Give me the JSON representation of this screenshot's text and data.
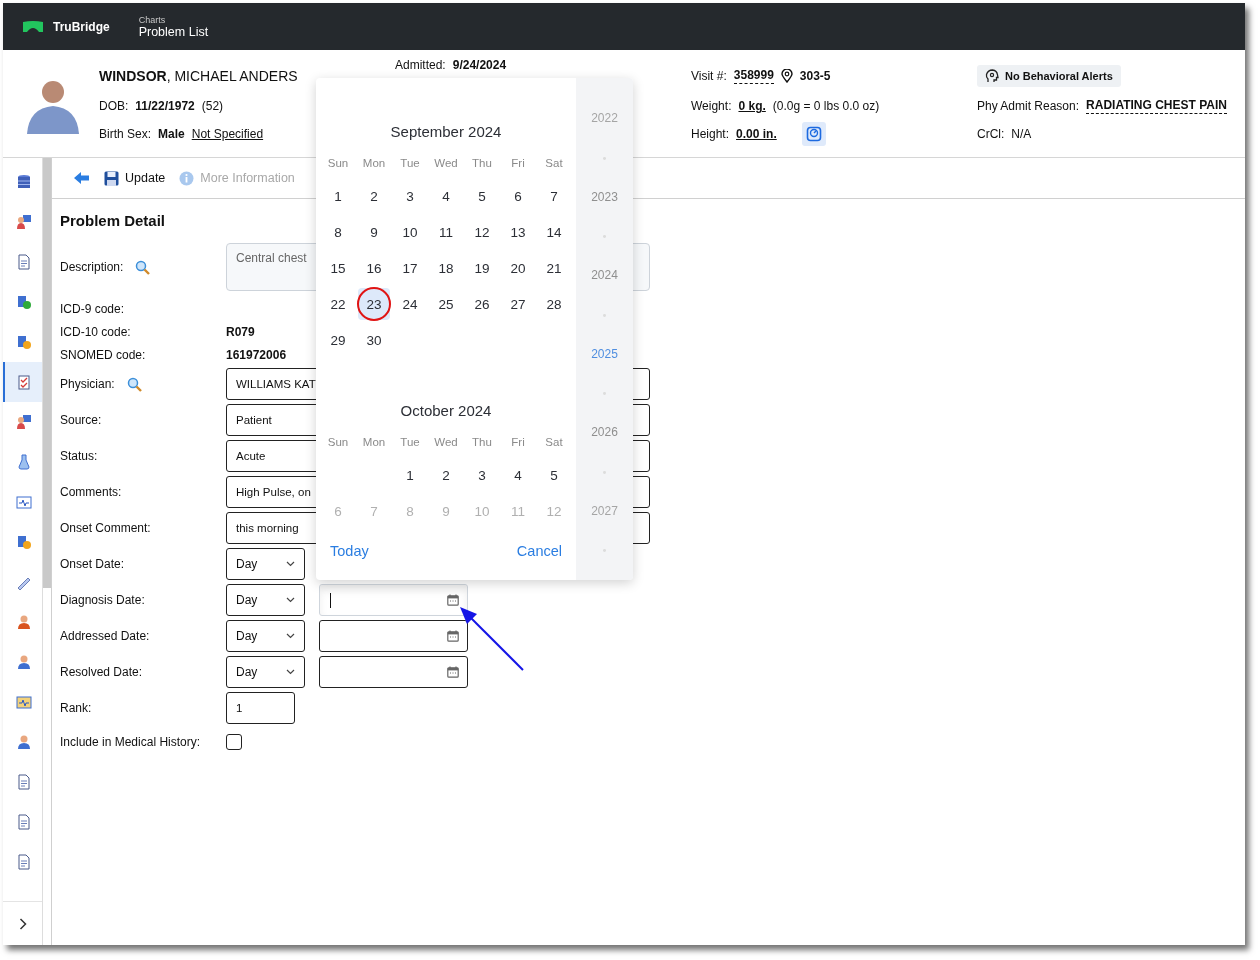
{
  "topbar": {
    "brand": "TruBridge",
    "section": "Charts",
    "page": "Problem List"
  },
  "patient": {
    "name": "**WINDSOR**, MICHAEL ANDERS",
    "dob_label": "DOB:",
    "dob": "11/22/1972",
    "age": "(52)",
    "sex_label": "Birth Sex:",
    "sex": "Male",
    "gender": "Not Specified",
    "admitted_label": "Admitted:",
    "admitted": "9/24/2024",
    "visit_label": "Visit #:",
    "visit": "358999",
    "room": "303-5",
    "weight_label": "Weight:",
    "weight": "0 kg.",
    "weight_detail": "(0.0g = 0 lbs 0.0 oz)",
    "height_label": "Height:",
    "height": "0.00 in.",
    "alerts": "No Behavioral Alerts",
    "reason_label": "Phy Admit Reason:",
    "reason": "RADIATING CHEST PAIN",
    "crcl_label": "CrCl:",
    "crcl": "N/A"
  },
  "sidebar": {
    "items": [
      {
        "selected": false
      },
      {
        "selected": false
      },
      {
        "selected": false
      },
      {
        "selected": false
      },
      {
        "selected": false
      },
      {
        "selected": true
      },
      {
        "selected": false
      },
      {
        "selected": false
      },
      {
        "selected": false
      },
      {
        "selected": false
      },
      {
        "selected": false
      },
      {
        "selected": false
      },
      {
        "selected": false
      },
      {
        "selected": false
      },
      {
        "selected": false
      },
      {
        "selected": false
      },
      {
        "selected": false
      },
      {
        "selected": false
      }
    ]
  },
  "toolbar": [
    {
      "kind": "back",
      "disabled": false
    },
    {
      "kind": "save",
      "label": "Update",
      "disabled": false
    },
    {
      "kind": "info",
      "label": "More Information",
      "disabled": true
    }
  ],
  "form": {
    "title": "Problem Detail",
    "rows": [
      {
        "kind": "textarea",
        "label": "Description:",
        "lookup": true,
        "value": "Central chest"
      },
      {
        "kind": "code",
        "label": "ICD-9 code:",
        "lookup": false
      },
      {
        "kind": "code",
        "label": "ICD-10 code:",
        "lookup": false,
        "value": "R079"
      },
      {
        "kind": "code",
        "label": "SNOMED code:",
        "lookup": false,
        "value": "161972006"
      },
      {
        "kind": "text",
        "label": "Physician:",
        "lookup": true,
        "value": "WILLIAMS KAT"
      },
      {
        "kind": "text",
        "label": "Source:",
        "lookup": false,
        "value": "Patient"
      },
      {
        "kind": "text",
        "label": "Status:",
        "lookup": false,
        "value": "Acute"
      },
      {
        "kind": "text",
        "label": "Comments:",
        "lookup": false,
        "value": "High Pulse, on"
      },
      {
        "kind": "text",
        "label": "Onset Comment:",
        "lookup": false,
        "value": "this morning"
      },
      {
        "kind": "date",
        "label": "Onset Date:",
        "lookup": false,
        "value": "Day"
      },
      {
        "kind": "date",
        "label": "Diagnosis Date:",
        "lookup": false,
        "value": "Day",
        "focused": true
      },
      {
        "kind": "date",
        "label": "Addressed Date:",
        "lookup": false,
        "value": "Day",
        "focused": false
      },
      {
        "kind": "date",
        "label": "Resolved Date:",
        "lookup": false,
        "value": "Day",
        "focused": false
      },
      {
        "kind": "number",
        "label": "Rank:",
        "lookup": false,
        "value": "1"
      },
      {
        "kind": "checkbox",
        "label": "Include in Medical History:",
        "lookup": false,
        "checked": false
      }
    ]
  },
  "datepicker": {
    "months": [
      {
        "title": "September 2024",
        "weekdays": [
          "Sun",
          "Mon",
          "Tue",
          "Wed",
          "Thu",
          "Fri",
          "Sat"
        ],
        "weeks": [
          {
            "faded": false,
            "days": [
              {
                "d": "1",
                "selected": false
              },
              {
                "d": "2",
                "selected": false
              },
              {
                "d": "3",
                "selected": false
              },
              {
                "d": "4",
                "selected": false
              },
              {
                "d": "5",
                "selected": false
              },
              {
                "d": "6",
                "selected": false
              },
              {
                "d": "7",
                "selected": false
              }
            ]
          },
          {
            "faded": false,
            "days": [
              {
                "d": "8",
                "selected": false
              },
              {
                "d": "9",
                "selected": false
              },
              {
                "d": "10",
                "selected": false
              },
              {
                "d": "11",
                "selected": false
              },
              {
                "d": "12",
                "selected": false
              },
              {
                "d": "13",
                "selected": false
              },
              {
                "d": "14",
                "selected": false
              }
            ]
          },
          {
            "faded": false,
            "days": [
              {
                "d": "15",
                "selected": false
              },
              {
                "d": "16",
                "selected": false
              },
              {
                "d": "17",
                "selected": false
              },
              {
                "d": "18",
                "selected": false
              },
              {
                "d": "19",
                "selected": false
              },
              {
                "d": "20",
                "selected": false
              },
              {
                "d": "21",
                "selected": false
              }
            ]
          },
          {
            "faded": false,
            "days": [
              {
                "d": "22",
                "selected": false
              },
              {
                "d": "23",
                "selected": true
              },
              {
                "d": "24",
                "selected": false
              },
              {
                "d": "25",
                "selected": false
              },
              {
                "d": "26",
                "selected": false
              },
              {
                "d": "27",
                "selected": false
              },
              {
                "d": "28",
                "selected": false
              }
            ]
          },
          {
            "faded": false,
            "days": [
              {
                "d": "29",
                "selected": false
              },
              {
                "d": "30",
                "selected": false
              }
            ]
          }
        ]
      },
      {
        "title": "October 2024",
        "weekdays": [
          "Sun",
          "Mon",
          "Tue",
          "Wed",
          "Thu",
          "Fri",
          "Sat"
        ],
        "weeks": [
          {
            "faded": false,
            "days": [
              {
                "d": "1",
                "selected": false
              },
              {
                "d": "2",
                "selected": false
              },
              {
                "d": "3",
                "selected": false
              },
              {
                "d": "4",
                "selected": false
              },
              {
                "d": "5",
                "selected": false
              }
            ]
          },
          {
            "faded": true,
            "days": [
              {
                "d": "6",
                "selected": false
              },
              {
                "d": "7",
                "selected": false
              },
              {
                "d": "8",
                "selected": false
              },
              {
                "d": "9",
                "selected": false
              },
              {
                "d": "10",
                "selected": false
              },
              {
                "d": "11",
                "selected": false
              },
              {
                "d": "12",
                "selected": false
              }
            ]
          }
        ]
      }
    ],
    "years": [
      {
        "label": "2022",
        "selected": false
      },
      {
        "label": "2023",
        "selected": false
      },
      {
        "label": "2024",
        "selected": false
      },
      {
        "label": "2025",
        "selected": true
      },
      {
        "label": "2026",
        "selected": false
      },
      {
        "label": "2027",
        "selected": false
      }
    ],
    "today": "Today",
    "cancel": "Cancel"
  },
  "annotations": {
    "circle": true,
    "arrow": true
  }
}
